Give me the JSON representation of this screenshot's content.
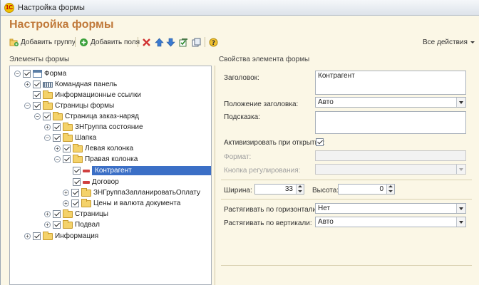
{
  "window": {
    "title": "Настройка формы",
    "app_logo": "1С"
  },
  "heading": "Настройка формы",
  "toolbar": {
    "add_group": "Добавить группу",
    "add_fields": "Добавить поля",
    "all_actions": "Все действия",
    "icons": [
      "add-group-icon",
      "add-fields-icon",
      "delete-icon",
      "move-up-icon",
      "move-down-icon",
      "check-all-icon",
      "copy-icon",
      "help-icon"
    ]
  },
  "tree": {
    "header": "Элементы формы",
    "items": [
      {
        "label": "Форма",
        "icon": "form-icon"
      },
      {
        "label": "Командная панель",
        "icon": "command-bar-icon"
      },
      {
        "label": "Информационные ссылки",
        "icon": "folder-icon"
      },
      {
        "label": "Страницы формы",
        "icon": "folder-icon"
      },
      {
        "label": "Страница заказ-наряд",
        "icon": "folder-icon"
      },
      {
        "label": "ЗНГруппа состояние",
        "icon": "folder-icon"
      },
      {
        "label": "Шапка",
        "icon": "folder-icon"
      },
      {
        "label": "Левая колонка",
        "icon": "folder-icon"
      },
      {
        "label": "Правая колонка",
        "icon": "folder-icon"
      },
      {
        "label": "Контрагент",
        "icon": "field-icon",
        "selected": true
      },
      {
        "label": "Договор",
        "icon": "field-icon"
      },
      {
        "label": "ЗНГруппаЗапланироватьОплату",
        "icon": "folder-icon"
      },
      {
        "label": "Цены и валюта документа",
        "icon": "folder-icon"
      },
      {
        "label": "Страницы",
        "icon": "folder-icon"
      },
      {
        "label": "Подвал",
        "icon": "folder-icon"
      },
      {
        "label": "Информация",
        "icon": "folder-icon"
      }
    ]
  },
  "props": {
    "header": "Свойства элемента формы",
    "title_label": "Заголовок:",
    "title_value": "Контрагент",
    "title_pos_label": "Положение заголовка:",
    "title_pos_value": "Авто",
    "hint_label": "Подсказка:",
    "hint_value": "",
    "activate_label": "Активизировать при открытии:",
    "format_label": "Формат:",
    "format_value": "",
    "reg_button_label": "Кнопка регулирования:",
    "reg_button_value": "",
    "width_label": "Ширина:",
    "width_value": "33",
    "height_label": "Высота:",
    "height_value": "0",
    "stretch_h_label": "Растягивать по горизонтали:",
    "stretch_h_value": "Нет",
    "stretch_v_label": "Растягивать по вертикали:",
    "stretch_v_value": "Авто"
  }
}
